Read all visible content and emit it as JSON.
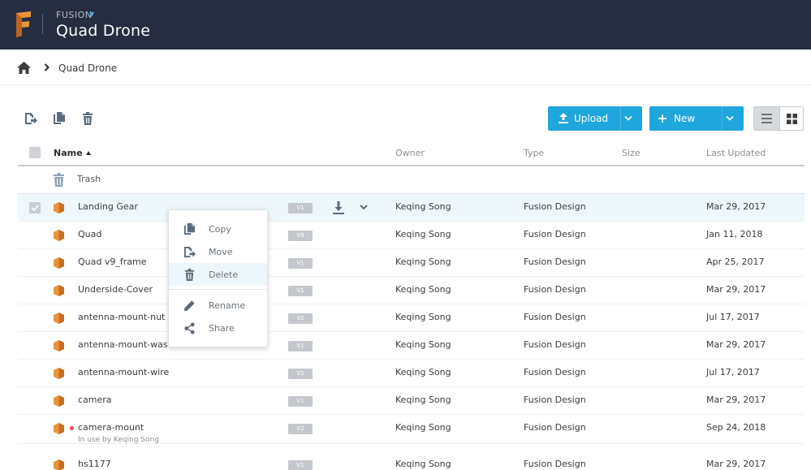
{
  "colors": {
    "header_bg": "#262d40",
    "accent_blue": "#1fa6dc",
    "logo_orange": "#e8953a",
    "lock_red": "#e5484d"
  },
  "header": {
    "app_name": "FUSION",
    "project_title": "Quad Drone"
  },
  "breadcrumb": {
    "current": "Quad Drone"
  },
  "toolbar": {
    "icons": [
      "move-icon",
      "copy-icon",
      "delete-icon"
    ],
    "upload_label": "Upload",
    "new_label": "New",
    "view_mode": "list"
  },
  "table": {
    "columns": {
      "name": "Name",
      "owner": "Owner",
      "type": "Type",
      "size": "Size",
      "last_updated": "Last Updated"
    },
    "trash_label": "Trash",
    "rows": [
      {
        "name": "Landing Gear",
        "version": "V1",
        "owner": "Keqing Song",
        "type": "Fusion Design",
        "updated": "Mar 29, 2017",
        "selected": true
      },
      {
        "name": "Quad",
        "version": "V9",
        "owner": "Keqing Song",
        "type": "Fusion Design",
        "updated": "Jan 11, 2018"
      },
      {
        "name": "Quad v9_frame",
        "version": "V1",
        "owner": "Keqing Song",
        "type": "Fusion Design",
        "updated": "Apr 25, 2017"
      },
      {
        "name": "Underside-Cover",
        "version": "V1",
        "owner": "Keqing Song",
        "type": "Fusion Design",
        "updated": "Mar 29, 2017"
      },
      {
        "name": "antenna-mount-nut",
        "version": "V2",
        "owner": "Keqing Song",
        "type": "Fusion Design",
        "updated": "Jul 17, 2017"
      },
      {
        "name": "antenna-mount-washer",
        "version": "V1",
        "owner": "Keqing Song",
        "type": "Fusion Design",
        "updated": "Mar 29, 2017"
      },
      {
        "name": "antenna-mount-wire",
        "version": "V2",
        "owner": "Keqing Song",
        "type": "Fusion Design",
        "updated": "Jul 17, 2017"
      },
      {
        "name": "camera",
        "version": "V1",
        "owner": "Keqing Song",
        "type": "Fusion Design",
        "updated": "Mar 29, 2017"
      },
      {
        "name": "camera-mount",
        "version": "V2",
        "owner": "Keqing Song",
        "type": "Fusion Design",
        "updated": "Sep 24, 2018",
        "status": "In use by Keqing Song"
      },
      {
        "name": "hs1177",
        "version": "V1",
        "owner": "Keqing Song",
        "type": "Fusion Design",
        "updated": "Mar 29, 2017"
      }
    ]
  },
  "context_menu": {
    "items": [
      {
        "label": "Copy",
        "icon": "copy-icon"
      },
      {
        "label": "Move",
        "icon": "move-icon"
      },
      {
        "label": "Delete",
        "icon": "delete-icon",
        "hovered": true
      },
      {
        "label": "Rename",
        "icon": "pencil-icon"
      },
      {
        "label": "Share",
        "icon": "share-icon"
      }
    ]
  }
}
